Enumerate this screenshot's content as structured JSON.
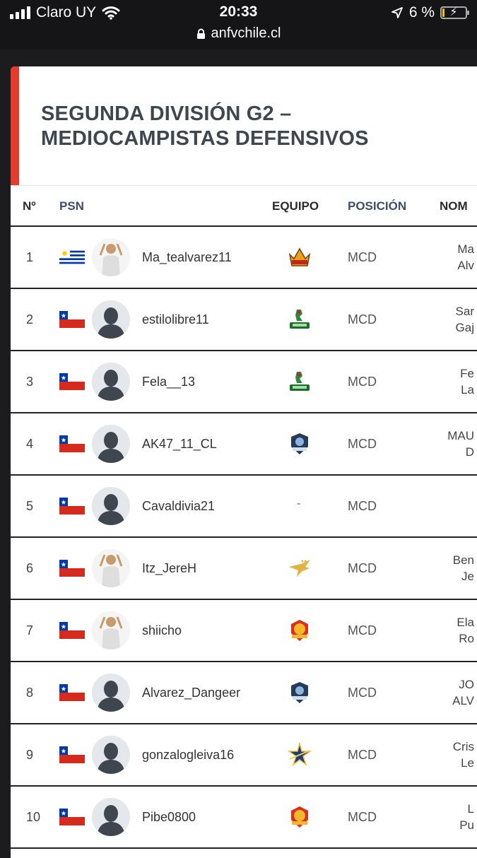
{
  "status_bar": {
    "carrier": "Claro UY",
    "time": "20:33",
    "battery_percent": "6 %",
    "battery_level": 0.06,
    "url": "anfvchile.cl"
  },
  "page": {
    "title": "SEGUNDA DIVISIÓN G2 – MEDIOCAMPISTAS DEFENSIVOS",
    "accent_color": "#e33b2c"
  },
  "table": {
    "columns": {
      "num": "Nº",
      "psn": "PSN",
      "team": "EQUIPO",
      "position": "POSICIÓN",
      "name": "NOM"
    },
    "rows": [
      {
        "num": "1",
        "flag": "uruguay-flag",
        "avatar": "player-photo",
        "psn": "Ma_tealvarez11",
        "team_logo": "crown-logo",
        "position": "MCD",
        "name": "Ma\nAlv"
      },
      {
        "num": "2",
        "flag": "chile-flag",
        "avatar": "default-avatar",
        "psn": "estilolibre11",
        "team_logo": "knight-logo",
        "position": "MCD",
        "name": "Sar\nGaj"
      },
      {
        "num": "3",
        "flag": "chile-flag",
        "avatar": "default-avatar",
        "psn": "Fela__13",
        "team_logo": "knight-logo",
        "position": "MCD",
        "name": "Fe\nLa"
      },
      {
        "num": "4",
        "flag": "chile-flag",
        "avatar": "default-avatar",
        "psn": "AK47_11_CL",
        "team_logo": "smart-logo",
        "position": "MCD",
        "name": "MAU\nD"
      },
      {
        "num": "5",
        "flag": "chile-flag",
        "avatar": "default-avatar",
        "psn": "Cavaldivia21",
        "team_logo": "",
        "team_text": "-",
        "position": "MCD",
        "name": ""
      },
      {
        "num": "6",
        "flag": "chile-flag",
        "avatar": "player-photo",
        "psn": "Itz_JereH",
        "team_logo": "eagle-logo",
        "position": "MCD",
        "name": "Ben\nJe"
      },
      {
        "num": "7",
        "flag": "chile-flag",
        "avatar": "player-photo",
        "psn": "shiicho",
        "team_logo": "lion-logo",
        "position": "MCD",
        "name": "Ela\nRo"
      },
      {
        "num": "8",
        "flag": "chile-flag",
        "avatar": "default-avatar",
        "psn": "Alvarez_Dangeer",
        "team_logo": "smart-logo",
        "position": "MCD",
        "name": "JO\nALV"
      },
      {
        "num": "9",
        "flag": "chile-flag",
        "avatar": "default-avatar",
        "psn": "gonzalogleiva16",
        "team_logo": "star-logo",
        "position": "MCD",
        "name": "Cris\nLe"
      },
      {
        "num": "10",
        "flag": "chile-flag",
        "avatar": "default-avatar",
        "psn": "Pibe0800",
        "team_logo": "lion-logo",
        "position": "MCD",
        "name": "L\nPu"
      }
    ]
  }
}
